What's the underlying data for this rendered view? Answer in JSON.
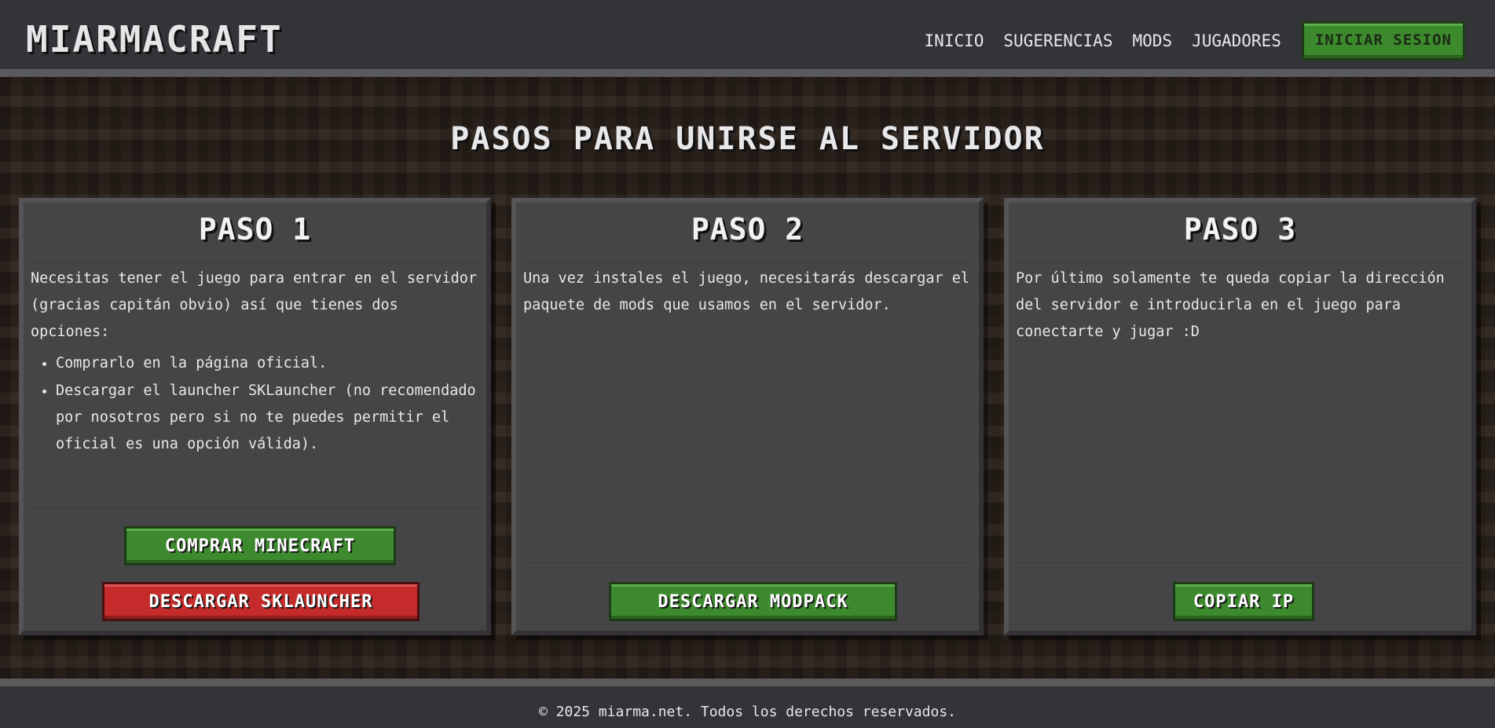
{
  "header": {
    "logo": "MIARMACRAFT",
    "nav": [
      "INICIO",
      "SUGERENCIAS",
      "MODS",
      "JUGADORES"
    ],
    "login_label": "INICIAR SESION"
  },
  "main": {
    "title": "PASOS PARA UNIRSE AL SERVIDOR",
    "steps": [
      {
        "title": "PASO 1",
        "text": "Necesitas tener el juego para entrar en el servidor (gracias capitán obvio) así que tienes dos opciones:",
        "list": [
          "Comprarlo en la página oficial.",
          "Descargar el launcher SKLauncher (no recomendado por nosotros pero si no te puedes permitir el oficial es una opción válida)."
        ],
        "buttons": [
          "COMPRAR MINECRAFT",
          "DESCARGAR SKLAUNCHER"
        ]
      },
      {
        "title": "PASO 2",
        "text": "Una vez instales el juego, necesitarás descargar el paquete de mods que usamos en el servidor.",
        "buttons": [
          "DESCARGAR MODPACK"
        ]
      },
      {
        "title": "PASO 3",
        "text": "Por último solamente te queda copiar la dirección del servidor e introducirla en el juego para conectarte y jugar :D",
        "buttons": [
          "COPIAR IP"
        ]
      }
    ]
  },
  "footer": {
    "text": "© 2025 miarma.net. Todos los derechos reservados."
  },
  "colors": {
    "green_button": "#3d8a2e",
    "red_button": "#c62b2b",
    "card_bg": "#454548",
    "header_bg": "#333437"
  }
}
